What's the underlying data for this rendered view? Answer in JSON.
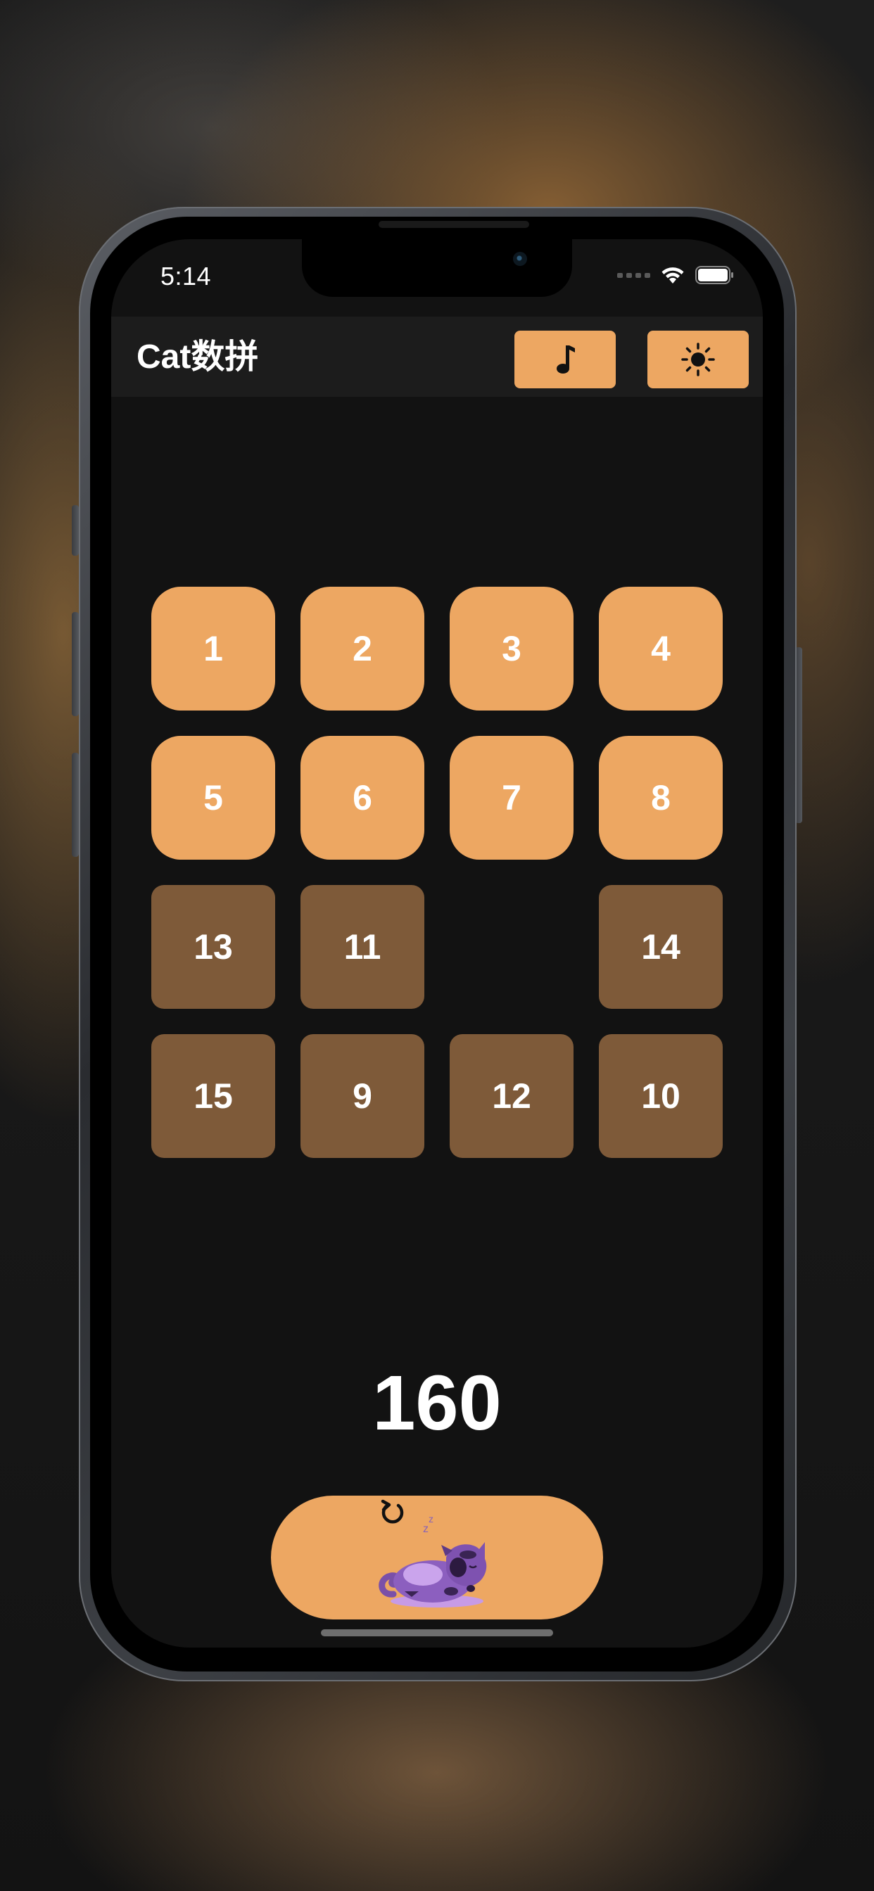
{
  "status_bar": {
    "time": "5:14",
    "icons": [
      "signal-dots-icon",
      "wifi-icon",
      "battery-icon"
    ]
  },
  "header": {
    "title": "Cat数拼",
    "music_button": {
      "icon": "music-note-icon"
    },
    "theme_button": {
      "icon": "sun-icon"
    }
  },
  "board": {
    "rows": [
      [
        "1",
        "2",
        "3",
        "4"
      ],
      [
        "5",
        "6",
        "7",
        "8"
      ],
      [
        "13",
        "11",
        "",
        "14"
      ],
      [
        "15",
        "9",
        "12",
        "10"
      ]
    ],
    "placed_tiles": [
      "1",
      "2",
      "3",
      "4",
      "5",
      "6",
      "7",
      "8"
    ],
    "unplaced_tiles": [
      "13",
      "11",
      "14",
      "15",
      "9",
      "12",
      "10"
    ],
    "empty_cell": {
      "row": 3,
      "column": 3
    }
  },
  "score": "160",
  "reset_button": {
    "icons": [
      "reset-icon",
      "sleeping-cat-icon"
    ]
  },
  "colors": {
    "accent": "#eda762",
    "tile_unplaced": "#7e5a39",
    "screen_background": "#121212",
    "header_background": "#1c1c1c",
    "cat_purple": "#9b6fc4"
  }
}
